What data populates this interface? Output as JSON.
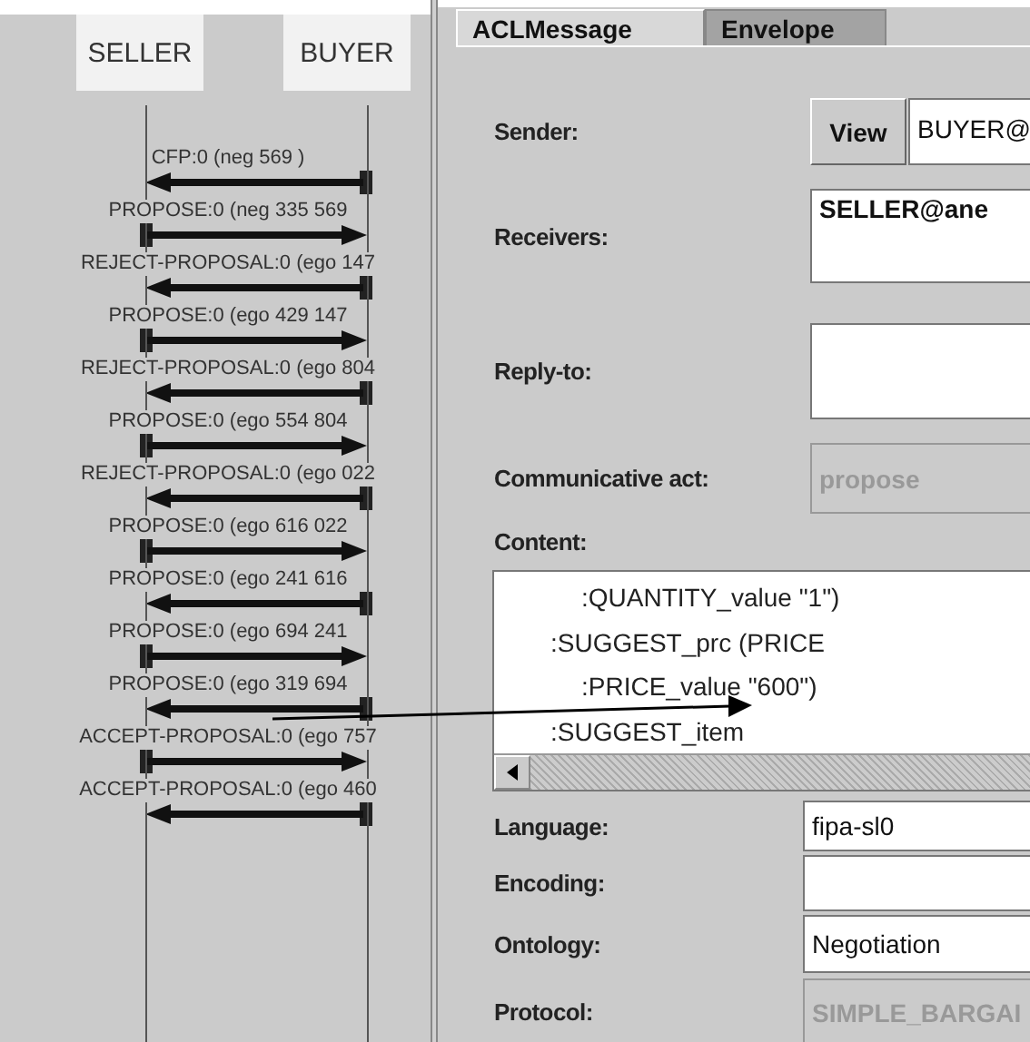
{
  "diagram": {
    "participants": [
      "SELLER",
      "BUYER"
    ],
    "messages": [
      {
        "label": "CFP:0 (neg 569 )",
        "from_buyer": true
      },
      {
        "label": "PROPOSE:0 (neg 335 569",
        "from_buyer": false
      },
      {
        "label": "REJECT-PROPOSAL:0 (ego 147",
        "from_buyer": true
      },
      {
        "label": "PROPOSE:0 (ego 429 147",
        "from_buyer": false
      },
      {
        "label": "REJECT-PROPOSAL:0 (ego 804",
        "from_buyer": true
      },
      {
        "label": "PROPOSE:0 (ego 554 804",
        "from_buyer": false
      },
      {
        "label": "REJECT-PROPOSAL:0 (ego 022",
        "from_buyer": true
      },
      {
        "label": "PROPOSE:0 (ego 616 022",
        "from_buyer": false
      },
      {
        "label": "PROPOSE:0 (ego 241 616",
        "from_buyer": true
      },
      {
        "label": "PROPOSE:0 (ego 694 241",
        "from_buyer": false
      },
      {
        "label": "PROPOSE:0 (ego 319 694",
        "from_buyer": true
      },
      {
        "label": "ACCEPT-PROPOSAL:0 (ego 757",
        "from_buyer": false
      },
      {
        "label": "ACCEPT-PROPOSAL:0 (ego 460",
        "from_buyer": true
      }
    ]
  },
  "tabs": [
    {
      "label": "ACLMessage",
      "selected": true
    },
    {
      "label": "Envelope",
      "selected": false
    }
  ],
  "sender": {
    "label": "Sender:",
    "button": "View",
    "value": "BUYER@"
  },
  "rows": [
    {
      "label": "Receivers:",
      "kind": "area",
      "value": "SELLER@ane",
      "disabled": false
    },
    {
      "label": "Reply-to:",
      "kind": "area",
      "disabled": false
    },
    {
      "label": "Communicative act:",
      "kind": "combo",
      "value": "propose",
      "disabled": true
    }
  ],
  "content": {
    "label": "Content:",
    "lines": [
      {
        "text": ":QUANTITY_value \"1\")",
        "kind": "inner"
      },
      {
        "text": ":SUGGEST_prc (PRICE",
        "kind": "outer"
      },
      {
        "text": ":PRICE_value \"600\")",
        "kind": "inner"
      },
      {
        "text": ":SUGGEST_item",
        "kind": "outer"
      }
    ]
  },
  "fields": [
    {
      "label": "Language:",
      "value": "fipa-sl0",
      "disabled": false
    },
    {
      "label": "Encoding:",
      "disabled": false
    },
    {
      "label": "Ontology:",
      "value": "Negotiation",
      "disabled": false
    },
    {
      "label": "Protocol:",
      "value": "SIMPLE_BARGAI",
      "disabled": true
    }
  ]
}
